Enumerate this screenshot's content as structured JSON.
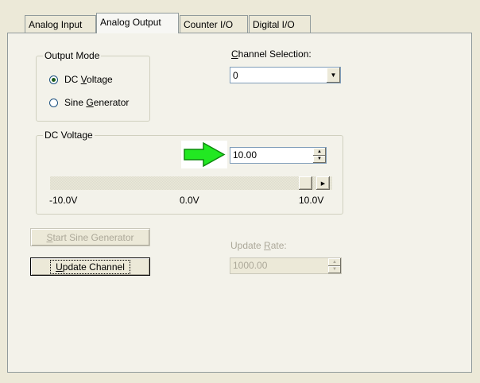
{
  "tabs": [
    {
      "label": "Analog Input",
      "active": false
    },
    {
      "label": "Analog Output",
      "active": true
    },
    {
      "label": "Counter I/O",
      "active": false
    },
    {
      "label": "Digital I/O",
      "active": false
    }
  ],
  "output_mode": {
    "title": "Output Mode",
    "options": [
      {
        "pre": "DC ",
        "u": "V",
        "post": "oltage",
        "selected": true
      },
      {
        "pre": "Sine ",
        "u": "G",
        "post": "enerator",
        "selected": false
      }
    ]
  },
  "channel": {
    "label_u": "C",
    "label_rest": "hannel Selection:",
    "value": "0"
  },
  "dc_voltage": {
    "title": "DC Voltage",
    "value": "10.00",
    "arrow_color": "#22e822",
    "slider_position_fraction": 1.0,
    "scale": {
      "min": "-10.0V",
      "mid": "0.0V",
      "max": "10.0V"
    }
  },
  "buttons": {
    "start_sine_u": "S",
    "start_sine_rest": "tart Sine Generator",
    "update_u": "U",
    "update_rest": "pdate Channel"
  },
  "update_rate": {
    "label_pre": "Update ",
    "label_u": "R",
    "label_post": "ate:",
    "value": "1000.00"
  },
  "icons": {
    "radio": "radio-dot",
    "dropdown": "▼",
    "spin_up": "▲",
    "spin_down": "▼",
    "scroll_left": "◀",
    "scroll_right": "▶"
  }
}
